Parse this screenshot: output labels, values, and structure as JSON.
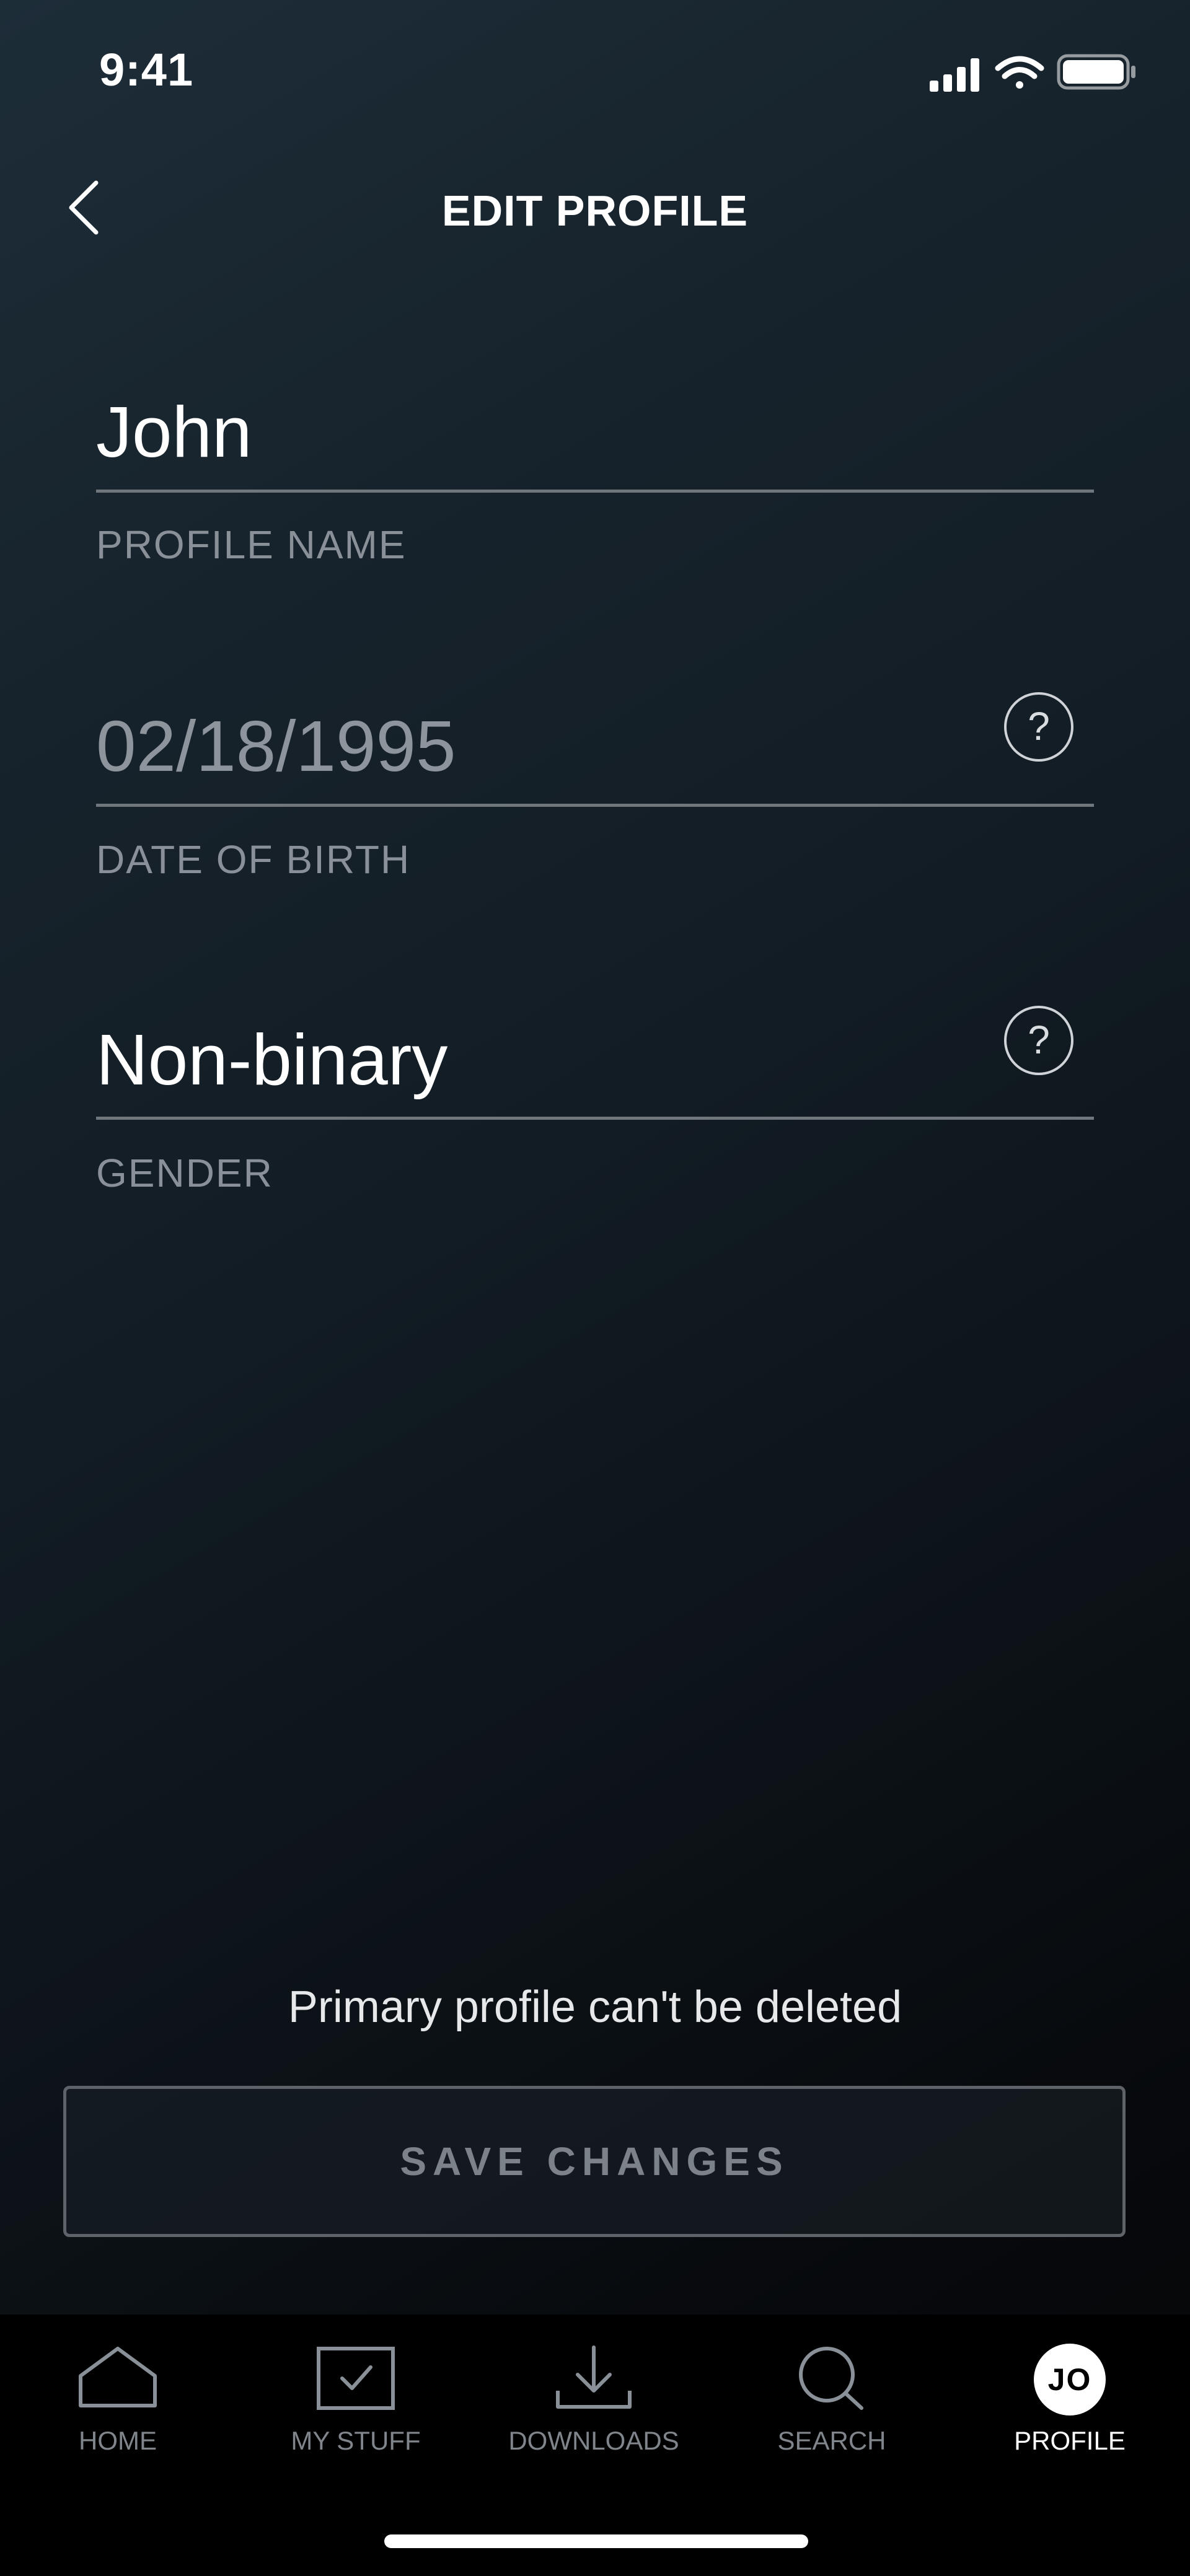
{
  "status_bar": {
    "time": "9:41",
    "icons": [
      "cellular-signal-icon",
      "wifi-icon",
      "battery-icon"
    ]
  },
  "header": {
    "title": "EDIT PROFILE",
    "back_icon": "chevron-left-icon"
  },
  "form": {
    "profile_name": {
      "value": "John",
      "label": "PROFILE NAME"
    },
    "date_of_birth": {
      "value": "02/18/1995",
      "label": "DATE OF BIRTH",
      "help": "?"
    },
    "gender": {
      "value": "Non-binary",
      "label": "GENDER",
      "help": "?"
    }
  },
  "notice": "Primary profile can't be deleted",
  "save_button": {
    "label": "SAVE CHANGES"
  },
  "bottom_nav": {
    "items": [
      {
        "label": "HOME",
        "icon": "home-icon"
      },
      {
        "label": "MY STUFF",
        "icon": "my-stuff-check-icon"
      },
      {
        "label": "DOWNLOADS",
        "icon": "download-icon"
      },
      {
        "label": "SEARCH",
        "icon": "search-icon"
      },
      {
        "label": "PROFILE",
        "icon": "avatar",
        "avatar_initials": "JO",
        "active": true
      }
    ]
  },
  "colors": {
    "background_top": "#1d2d38",
    "background_bottom": "#050608",
    "muted_text": "#8a9097",
    "button_border": "#5d6369"
  }
}
